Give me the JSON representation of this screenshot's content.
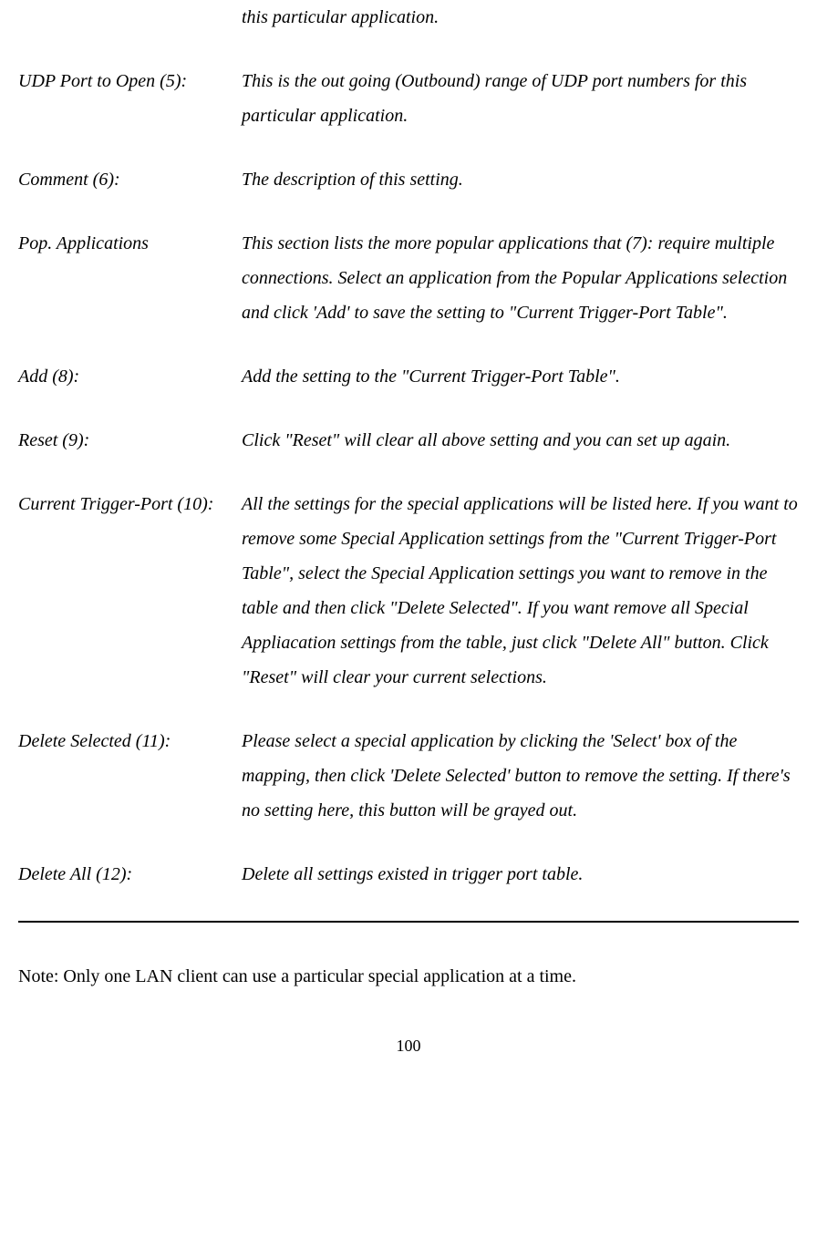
{
  "fragment_top": "this particular application.",
  "entries": [
    {
      "term": "UDP Port to Open (5):",
      "desc": "This is the out going (Outbound) range of UDP port numbers for this particular application."
    },
    {
      "term": "Comment (6):",
      "desc": "The description of this setting."
    },
    {
      "term": "Pop. Applications",
      "desc": "This section lists the more popular applications that (7):   require multiple connections. Select an application from the Popular Applications selection and click 'Add' to save the setting to \"Current Trigger-Port Table\"."
    },
    {
      "term": "Add (8):",
      "desc": "Add the setting to the \"Current Trigger-Port Table\"."
    },
    {
      "term": "Reset (9):",
      "desc": "Click \"Reset\" will clear all above setting and you can set up again."
    },
    {
      "term": "Current Trigger-Port (10):",
      "desc": "All the settings for the special applications will be listed here. If you want to remove some Special Application settings from the \"Current Trigger-Port Table\", select the Special Application settings you want to remove in the table and then click \"Delete Selected\". If you want remove all Special Appliacation settings from the table, just click \"Delete All\" button. Click \"Reset\" will clear your current selections."
    },
    {
      "term": "Delete Selected (11):",
      "desc": "Please select a special application by clicking the 'Select' box of the mapping, then click 'Delete Selected' button to remove the setting. If there's no setting here, this button will be grayed out."
    },
    {
      "term": "Delete All (12):",
      "desc": "Delete all settings existed in trigger port table."
    }
  ],
  "note": "Note: Only one LAN client can use a particular special application at a time.",
  "page_number": "100"
}
